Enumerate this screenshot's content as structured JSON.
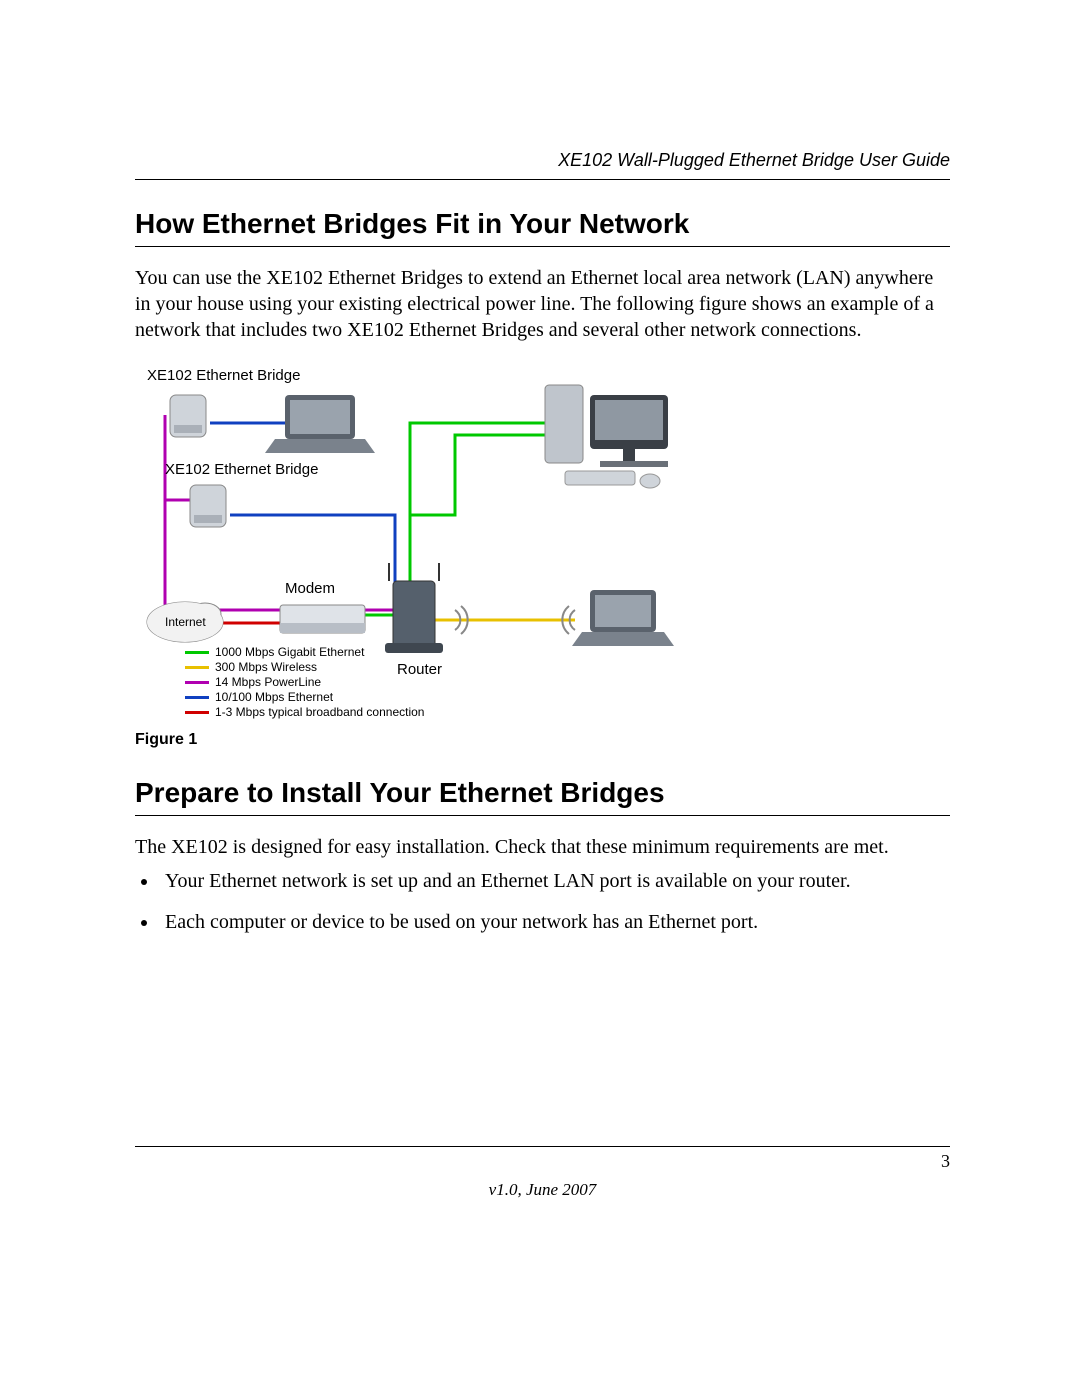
{
  "header": {
    "title": "XE102 Wall-Plugged Ethernet Bridge User Guide"
  },
  "sections": {
    "s1": {
      "heading": "How Ethernet Bridges Fit in Your Network",
      "paragraph": "You can use the XE102 Ethernet Bridges to extend an Ethernet local area network (LAN) anywhere in your house using your existing electrical power line. The following figure shows an example of a network that includes two XE102 Ethernet Bridges and several other network connections."
    },
    "s2": {
      "heading": "Prepare to Install Your Ethernet Bridges",
      "paragraph": "The XE102 is designed for easy installation. Check that these minimum requirements are met.",
      "bullets": [
        "Your Ethernet network is set up and an Ethernet LAN port is available on your router.",
        "Each computer or device to be used on your network has an Ethernet port."
      ]
    }
  },
  "figure": {
    "caption": "Figure 1",
    "labels": {
      "bridge1": "XE102 Ethernet Bridge",
      "bridge2": "XE102 Ethernet Bridge",
      "modem": "Modem",
      "router": "Router",
      "internet": "Internet"
    },
    "legend": [
      {
        "color": "#00c800",
        "text": "1000 Mbps Gigabit Ethernet"
      },
      {
        "color": "#e8c000",
        "text": "300 Mbps Wireless"
      },
      {
        "color": "#b000b0",
        "text": "14 Mbps PowerLine"
      },
      {
        "color": "#1040c0",
        "text": "10/100 Mbps Ethernet"
      },
      {
        "color": "#d00000",
        "text": "1-3 Mbps typical broadband connection"
      }
    ]
  },
  "footer": {
    "page": "3",
    "version": "v1.0, June 2007"
  }
}
